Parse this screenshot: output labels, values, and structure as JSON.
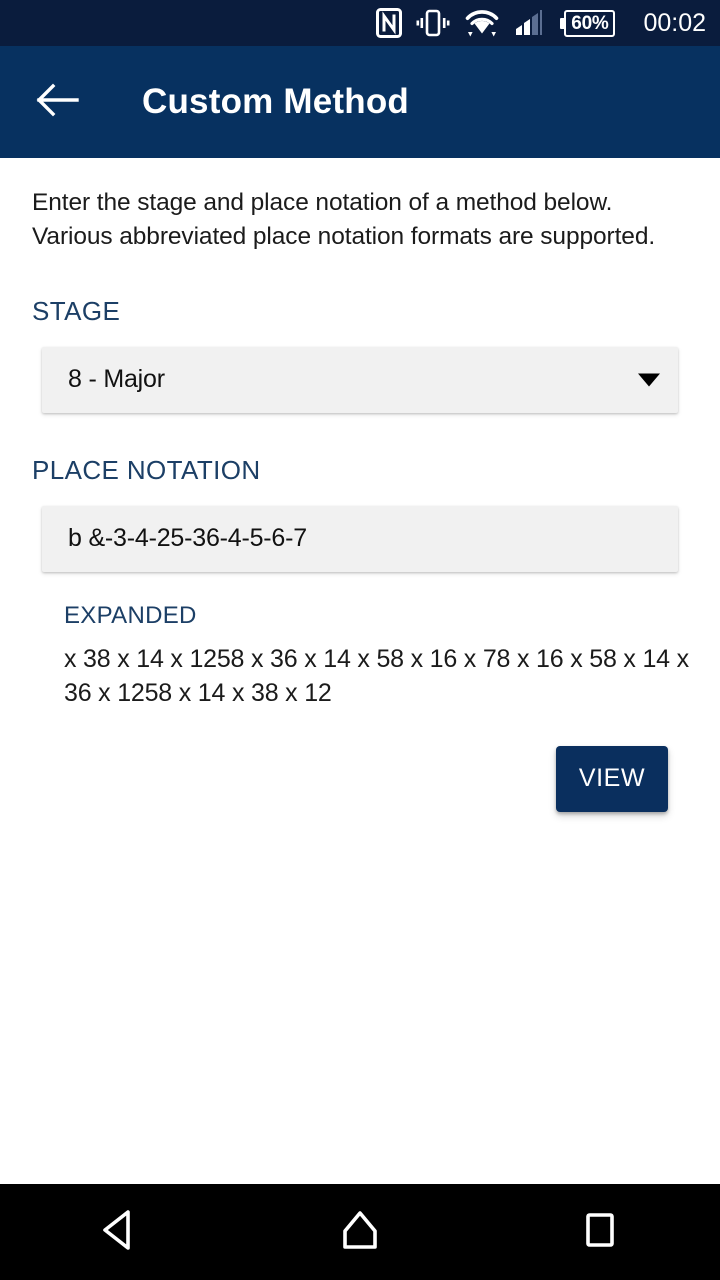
{
  "statusbar": {
    "icons": [
      "nfc-icon",
      "vibrate-icon",
      "wifi-icon",
      "cell-signal-icon"
    ],
    "battery_percent": "60%",
    "clock": "00:02",
    "background_color": "#0a1c3d"
  },
  "appbar": {
    "back_icon": "arrow-left-icon",
    "title": "Custom Method",
    "background_color": "#073160"
  },
  "main": {
    "description": "Enter the stage and place notation of a method below. Various abbreviated place notation formats are supported.",
    "stage": {
      "label": "STAGE",
      "selected_value": "8 - Major",
      "chevron_icon": "chevron-down-icon"
    },
    "place_notation": {
      "label": "PLACE NOTATION",
      "value": "b &-3-4-25-36-4-5-6-7",
      "placeholder": "Place notation"
    },
    "expanded": {
      "label": "EXPANDED",
      "value": "x 38 x 14 x 1258 x 36 x 14 x 58 x 16 x 78 x 16 x 58 x 14 x 36 x 1258 x 14 x 38 x 12"
    },
    "view_button": "VIEW",
    "label_color": "#1c3f66",
    "accent_color": "#0a2f5e"
  },
  "navbar": {
    "back": "nav-back-icon",
    "home": "nav-home-icon",
    "recents": "nav-recents-icon",
    "background_color": "#000000"
  }
}
